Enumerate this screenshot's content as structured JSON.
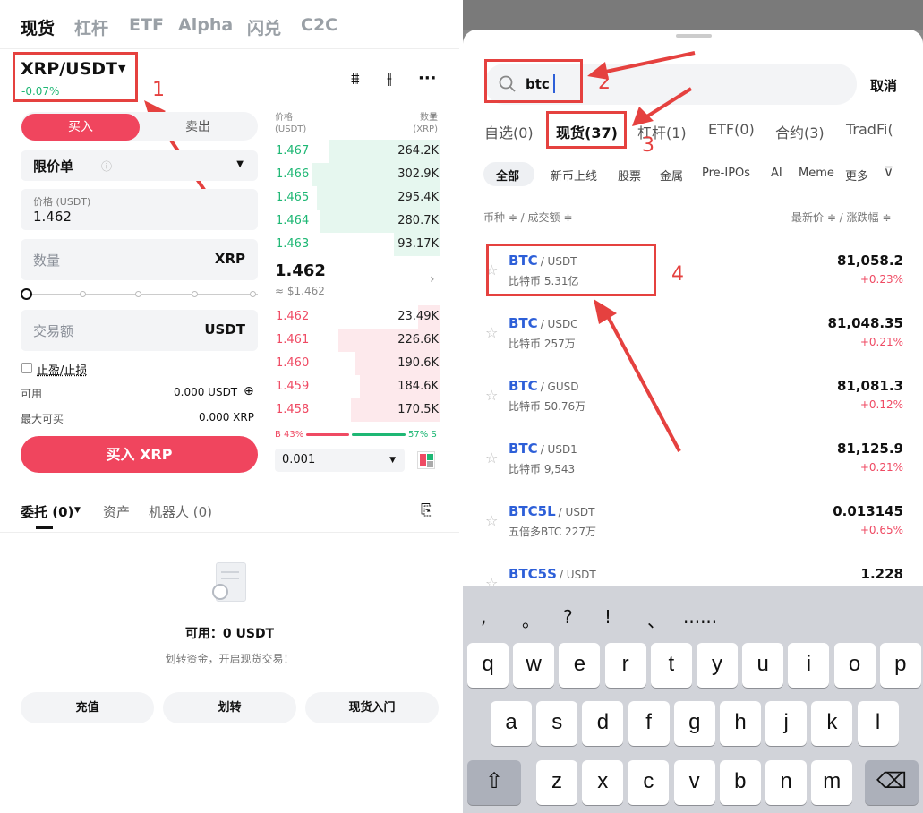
{
  "left": {
    "top_tabs": [
      "现货",
      "杠杆",
      "ETF",
      "Alpha",
      "闪兑",
      "C2C"
    ],
    "pair": "XRP/USDT",
    "pair_change": "-0.07%",
    "buy_label": "买入",
    "sell_label": "卖出",
    "order_type": "限价单",
    "price_label": "价格 (USDT)",
    "price_value": "1.462",
    "qty_placeholder": "数量",
    "qty_unit": "XRP",
    "amount_placeholder": "交易额",
    "amount_unit": "USDT",
    "tpsl_label": "止盈/止损",
    "avail_label": "可用",
    "avail_value": "0.000 USDT",
    "max_label": "最大可买",
    "max_value": "0.000 XRP",
    "buy_button": "买入 XRP",
    "orderbook": {
      "price_header": "价格",
      "price_unit": "(USDT)",
      "qty_header": "数量",
      "qty_unit": "(XRP)",
      "bids": [
        {
          "price": "1.467",
          "qty": "264.2K",
          "depth": 0.65
        },
        {
          "price": "1.466",
          "qty": "302.9K",
          "depth": 0.75
        },
        {
          "price": "1.465",
          "qty": "295.4K",
          "depth": 0.72
        },
        {
          "price": "1.464",
          "qty": "280.7K",
          "depth": 0.7
        },
        {
          "price": "1.463",
          "qty": "93.17K",
          "depth": 0.27
        }
      ],
      "last_price": "1.462",
      "last_price_usd": "≈ $1.462",
      "asks": [
        {
          "price": "1.462",
          "qty": "23.49K",
          "depth": 0.13
        },
        {
          "price": "1.461",
          "qty": "226.6K",
          "depth": 0.6
        },
        {
          "price": "1.460",
          "qty": "190.6K",
          "depth": 0.5
        },
        {
          "price": "1.459",
          "qty": "184.6K",
          "depth": 0.47
        },
        {
          "price": "1.458",
          "qty": "170.5K",
          "depth": 0.52
        }
      ],
      "buy_ratio": "B 43%",
      "sell_ratio": "57% S",
      "precision": "0.001"
    },
    "bottom_tabs": [
      "委托 (0)",
      "资产",
      "机器人 (0)"
    ],
    "empty_available": "可用：0 USDT",
    "empty_hint": "划转资金，开启现货交易！",
    "buttons": [
      "充值",
      "划转",
      "现货入门"
    ],
    "annotation_1": "1"
  },
  "right": {
    "search_value": "btc",
    "cancel": "取消",
    "tabs": [
      "自选(0)",
      "现货(37)",
      "杠杆(1)",
      "ETF(0)",
      "合约(3)",
      "TradFi("
    ],
    "chips": [
      "全部",
      "新币上线",
      "股票",
      "金属",
      "Pre-IPOs",
      "AI",
      "Meme",
      "更多"
    ],
    "header_left": "币种 ≑ / 成交额 ≑",
    "header_right": "最新价 ≑ / 涨跌幅 ≑",
    "coins": [
      {
        "base": "BTC",
        "quote": "/ USDT",
        "name": "比特币 5.31亿",
        "price": "81,058.2",
        "change": "+0.23%"
      },
      {
        "base": "BTC",
        "quote": "/ USDC",
        "name": "比特币 257万",
        "price": "81,048.35",
        "change": "+0.21%"
      },
      {
        "base": "BTC",
        "quote": "/ GUSD",
        "name": "比特币 50.76万",
        "price": "81,081.3",
        "change": "+0.12%"
      },
      {
        "base": "BTC",
        "quote": "/ USD1",
        "name": "比特币 9,543",
        "price": "81,125.9",
        "change": "+0.21%"
      },
      {
        "base": "BTC5L",
        "quote": "/ USDT",
        "name": "五倍多BTC 227万",
        "price": "0.013145",
        "change": "+0.65%"
      },
      {
        "base": "BTC5S",
        "quote": "/ USDT",
        "name": "",
        "price": "1.228",
        "change": ""
      }
    ],
    "punctuation": [
      ",",
      "。",
      "?",
      "!",
      "、",
      "......"
    ],
    "keys_row1": [
      "q",
      "w",
      "e",
      "r",
      "t",
      "y",
      "u",
      "i",
      "o",
      "p"
    ],
    "keys_row2": [
      "a",
      "s",
      "d",
      "f",
      "g",
      "h",
      "j",
      "k",
      "l"
    ],
    "keys_row3": [
      "z",
      "x",
      "c",
      "v",
      "b",
      "n",
      "m"
    ],
    "annotation_2": "2",
    "annotation_3": "3",
    "annotation_4": "4"
  },
  "colors": {
    "buy": "#f0455e",
    "green": "#1eb774",
    "annotation": "#e5413f",
    "link": "#2d5fd8"
  }
}
